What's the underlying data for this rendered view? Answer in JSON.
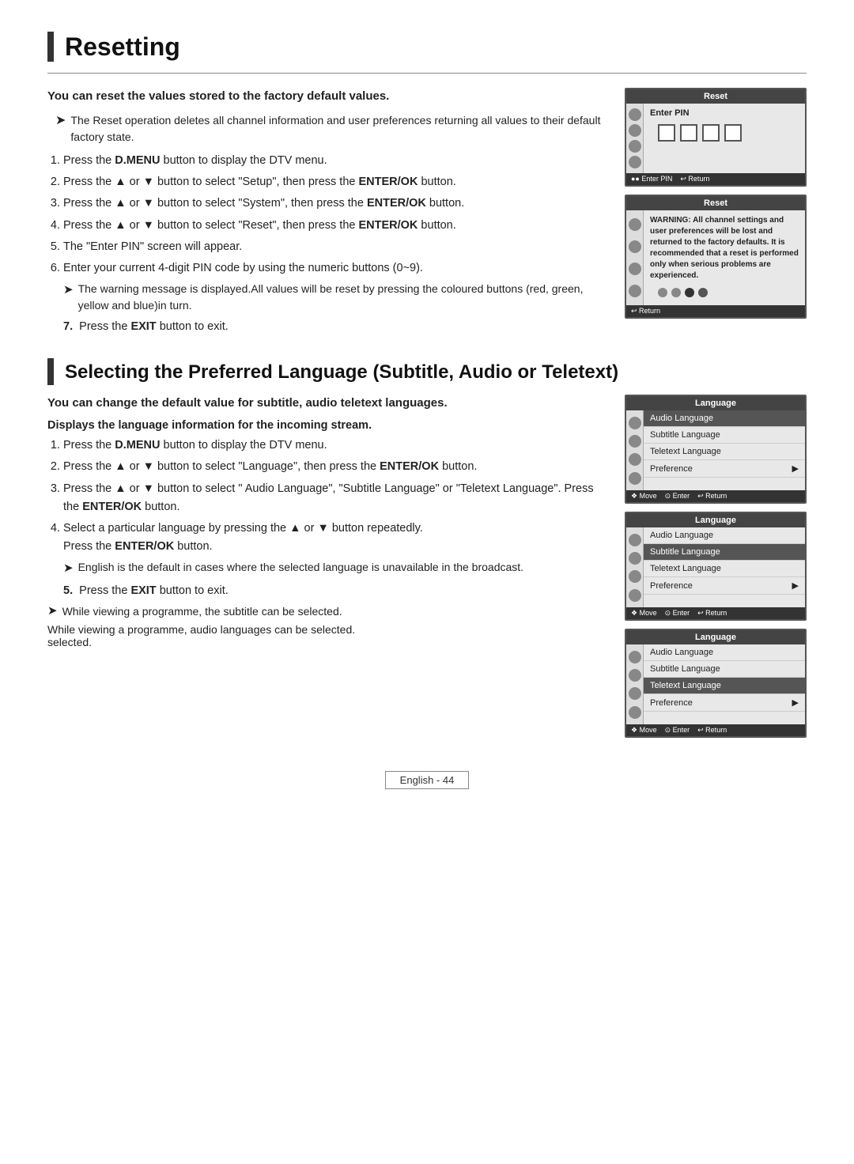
{
  "resetting": {
    "title": "Resetting",
    "intro_bold": "You can reset the values stored to the factory default values.",
    "note1": "The Reset operation deletes all channel information and user preferences returning all values to their default factory state.",
    "steps": [
      "Press the D.MENU button to display the DTV menu.",
      "Press the ▲ or ▼ button to select \"Setup\", then press the ENTER/OK button.",
      "Press the ▲ or ▼ button to select \"System\", then press the ENTER/OK button.",
      "Press the ▲ or ▼ button to select \"Reset\", then press the ENTER/OK button.",
      "The \"Enter PIN\" screen will appear.",
      "Enter your current 4-digit PIN code by using the numeric buttons (0~9)."
    ],
    "step6_note": "The warning message is displayed.All values will be reset by pressing the coloured buttons (red, green, yellow and blue)in turn.",
    "step7": "Press the EXIT button to exit.",
    "screen1_title": "Reset",
    "screen1_label": "Enter PIN",
    "screen1_footer1": "●● Enter PIN",
    "screen1_footer2": "↩ Return",
    "screen2_title": "Reset",
    "screen2_warning": "WARNING: All channel settings and user preferences will be lost and returned to the factory defaults. It is recommended that a reset is performed only when serious problems are experienced.",
    "screen2_footer": "↩ Return"
  },
  "language": {
    "title": "Selecting the Preferred Language (Subtitle, Audio or Teletext)",
    "intro_bold": "You can change the default value for subtitle, audio teletext languages.",
    "display_label": "Displays the language information for the incoming stream.",
    "steps": [
      "Press the D.MENU button to display the DTV menu.",
      "Press the ▲ or ▼ button to select \"Language\", then press the ENTER/OK button.",
      "Press the ▲ or ▼ button to select \" Audio Language\", \"Subtitle Language\" or \"Teletext Language\". Press the ENTER/OK button.",
      "Select a particular language by pressing the ▲ or ▼ button repeatedly."
    ],
    "step4_note": "Press the ENTER/OK button.",
    "step4_tip": "English is the default in cases where the selected language is unavailable in the broadcast.",
    "step5": "Press the EXIT button to exit.",
    "note_programme1": "While viewing a programme, the subtitle can be selected.",
    "note_programme2": "While viewing a programme, audio languages can be selected.",
    "screen_title": "Language",
    "menu_items": [
      "Audio Language",
      "Subtitle Language",
      "Teletext Language",
      "Preference"
    ],
    "screen_footer1": "❖ Move",
    "screen_footer2": "⊙ Enter",
    "screen_footer3": "↩ Return"
  },
  "footer": {
    "label": "English - 44"
  }
}
